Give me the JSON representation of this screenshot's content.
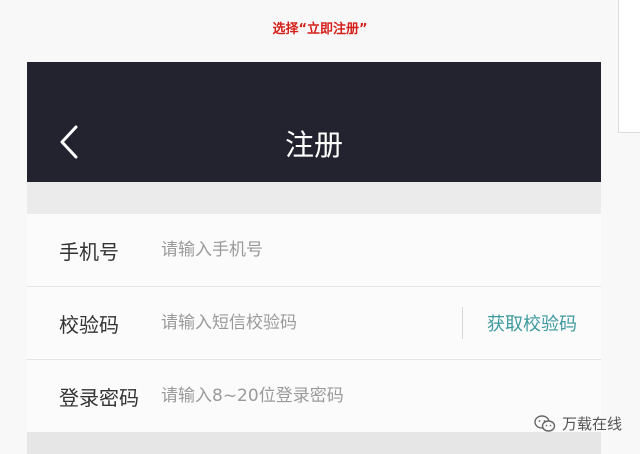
{
  "caption": "选择“立即注册”",
  "header": {
    "title": "注册"
  },
  "form": {
    "phone": {
      "label": "手机号",
      "placeholder": "请输入手机号"
    },
    "code": {
      "label": "校验码",
      "placeholder": "请输入短信校验码",
      "button_label": "获取校验码"
    },
    "password": {
      "label": "登录密码",
      "placeholder": "请输入8~20位登录密码"
    }
  },
  "watermark": {
    "text": "万载在线",
    "icon": "wechat-icon"
  },
  "colors": {
    "caption": "#d4201b",
    "navbar": "#23232f",
    "link": "#3d9a9e"
  }
}
